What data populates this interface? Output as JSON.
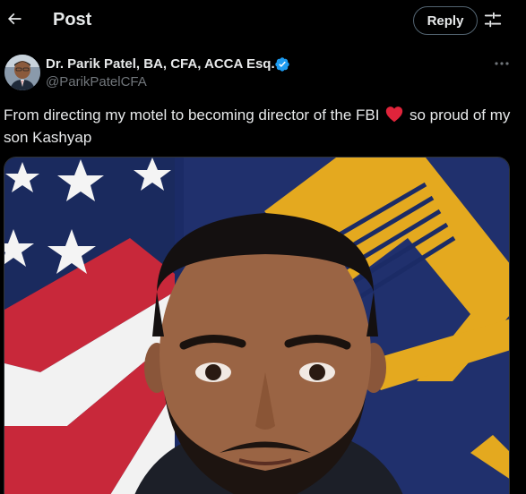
{
  "header": {
    "title": "Post",
    "reply_label": "Reply",
    "back_icon": "arrow-left-icon",
    "filter_icon": "sliders-icon"
  },
  "post": {
    "author": {
      "display_name": "Dr. Parik Patel, BA, CFA, ACCA Esq.",
      "handle": "@ParikPatelCFA",
      "verified": true
    },
    "text_before_emoji": "From directing my motel to becoming director of the FBI",
    "emoji": "red-heart",
    "text_after_emoji": " so proud of my son Kashyap",
    "media": {
      "kind": "photo"
    }
  },
  "colors": {
    "background": "#000000",
    "text_primary": "#e7e9ea",
    "text_secondary": "#71767b",
    "verified_badge": "#1d9bf0",
    "heart": "#f91880"
  }
}
